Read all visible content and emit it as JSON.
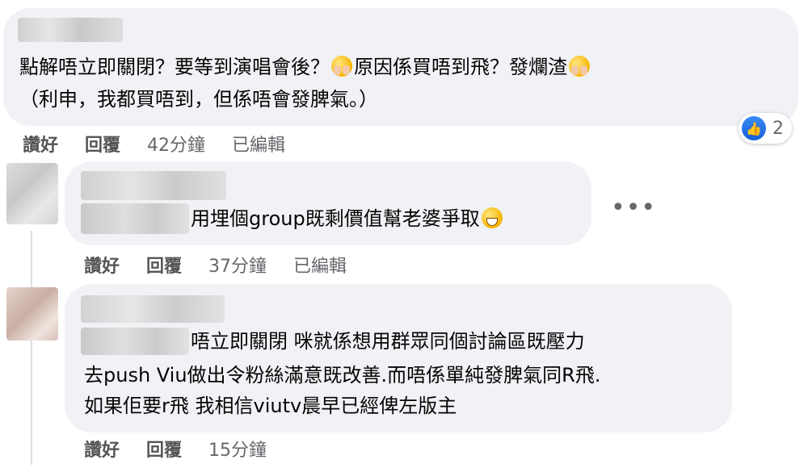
{
  "comments": [
    {
      "text_line1": "點解唔立即關閉？要等到演唱會後？",
      "text_line1_b": "原因係買唔到飛？發爛渣",
      "text_line2": "（利申，我都買唔到，但係唔會發脾氣。）",
      "emoji_1": "shy-hands-face-emoji",
      "emoji_2": "shy-hands-face-emoji",
      "actions": {
        "like": "讚好",
        "reply": "回覆",
        "time": "42分鐘",
        "edited": "已編輯"
      },
      "reaction": {
        "icon": "thumbs-up-icon",
        "count": "2",
        "color": "#1877f2"
      }
    },
    {
      "text_line1": "用埋個group既剩價值幫老婆爭取",
      "emoji_1": "tears-of-joy-emoji",
      "more_label": "•••",
      "actions": {
        "like": "讚好",
        "reply": "回覆",
        "time": "37分鐘",
        "edited": "已編輯"
      }
    },
    {
      "text_line1": "唔立即關閉 咪就係想用群眾同個討論區既壓力",
      "text_line2": "去push Viu做出令粉絲滿意既改善.而唔係單純發脾氣同R飛.",
      "text_line3": "如果佢要r飛 我相信viutv晨早已經俾左版主",
      "actions": {
        "like": "讚好",
        "reply": "回覆",
        "time": "15分鐘"
      }
    }
  ]
}
